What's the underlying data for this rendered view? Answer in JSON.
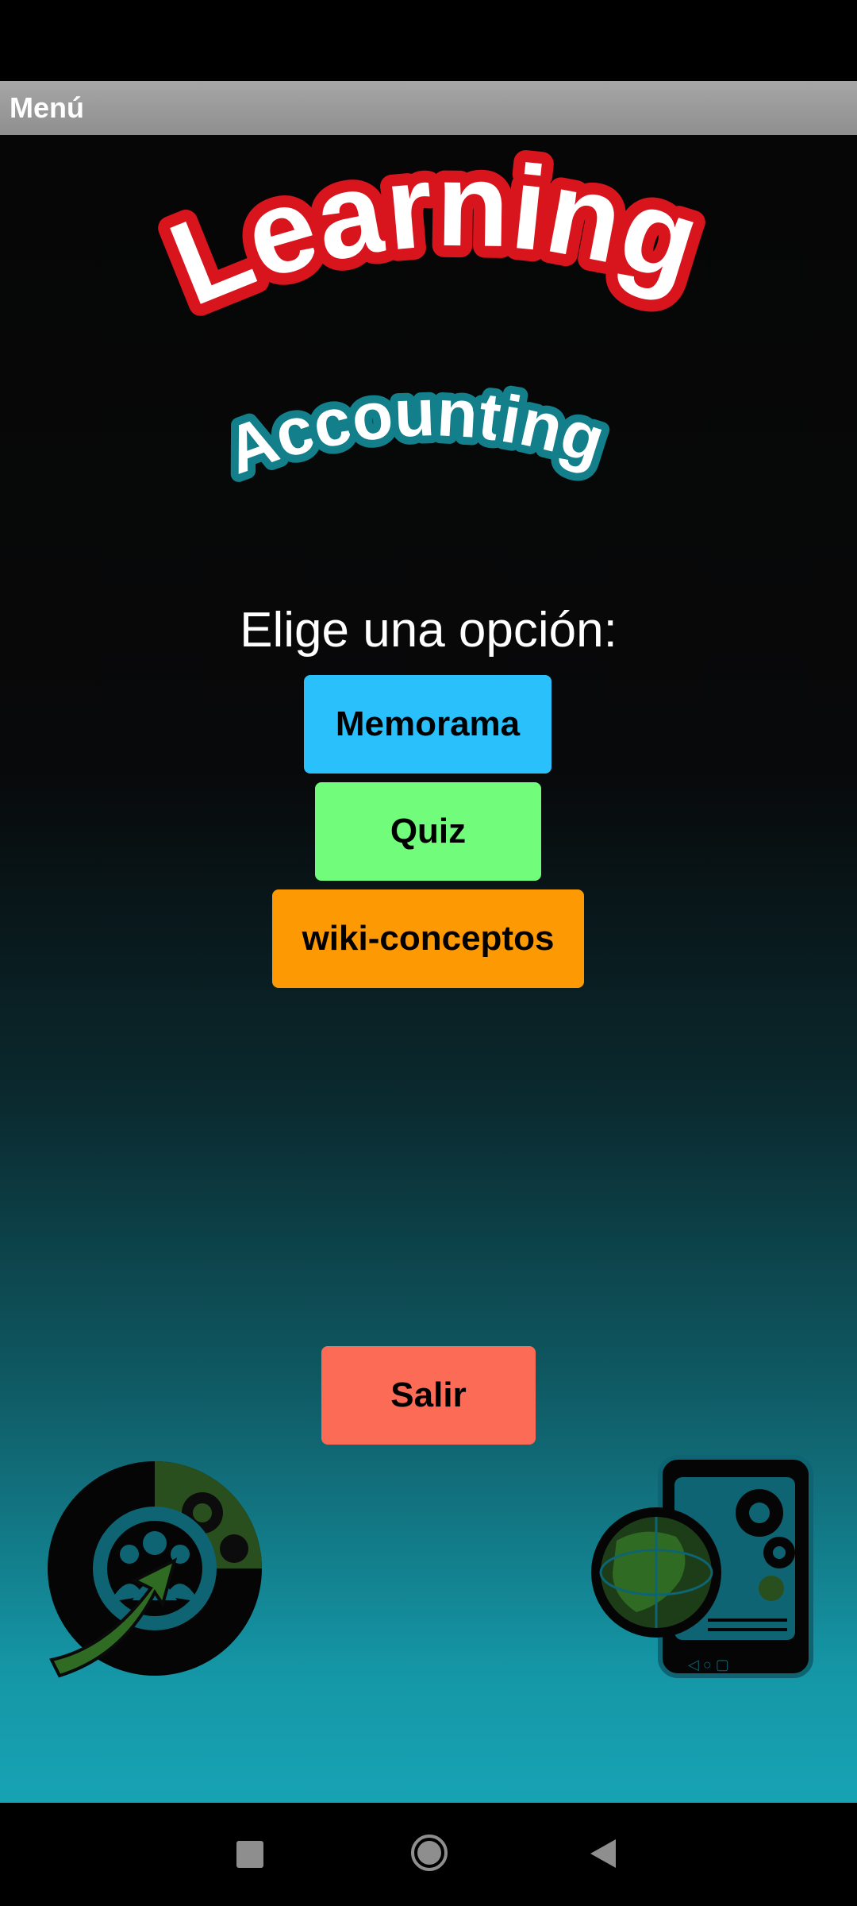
{
  "titlebar": {
    "title": "Menú"
  },
  "logo": {
    "line1": "Learning",
    "line2": "Accounting"
  },
  "main": {
    "prompt": "Elige una opción:",
    "buttons": {
      "memorama": "Memorama",
      "quiz": "Quiz",
      "wiki": "wiki-conceptos",
      "salir": "Salir"
    }
  },
  "icons": {
    "bottom_left": "team-growth-gear-icon",
    "bottom_right": "globe-gears-tablet-icon",
    "nav_recent": "square-icon",
    "nav_home": "circle-home-icon",
    "nav_back": "triangle-back-icon"
  },
  "colors": {
    "memorama": "#29c0fb",
    "quiz": "#71fc7c",
    "wiki": "#fd9a03",
    "salir": "#fc6b55",
    "logo_red": "#d8141d",
    "logo_teal": "#127f8a"
  }
}
